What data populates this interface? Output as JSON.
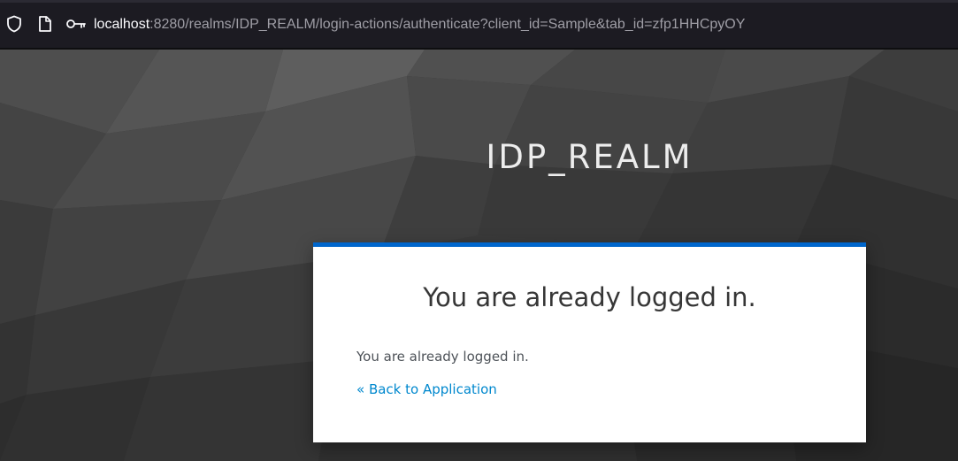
{
  "browser": {
    "url_host": "localhost",
    "url_rest": ":8280/realms/IDP_REALM/login-actions/authenticate?client_id=Sample&tab_id=zfp1HHCpyOY",
    "icons": [
      "shield-icon",
      "page-icon",
      "key-icon"
    ]
  },
  "realm": {
    "title": "IDP_REALM"
  },
  "card": {
    "heading": "You are already logged in.",
    "message": "You are already logged in.",
    "back_link": "« Back to Application"
  },
  "colors": {
    "accent": "#0066cc",
    "link": "#0088ce",
    "background": "#3a3a3a",
    "addressbar": "#1c1b22"
  }
}
